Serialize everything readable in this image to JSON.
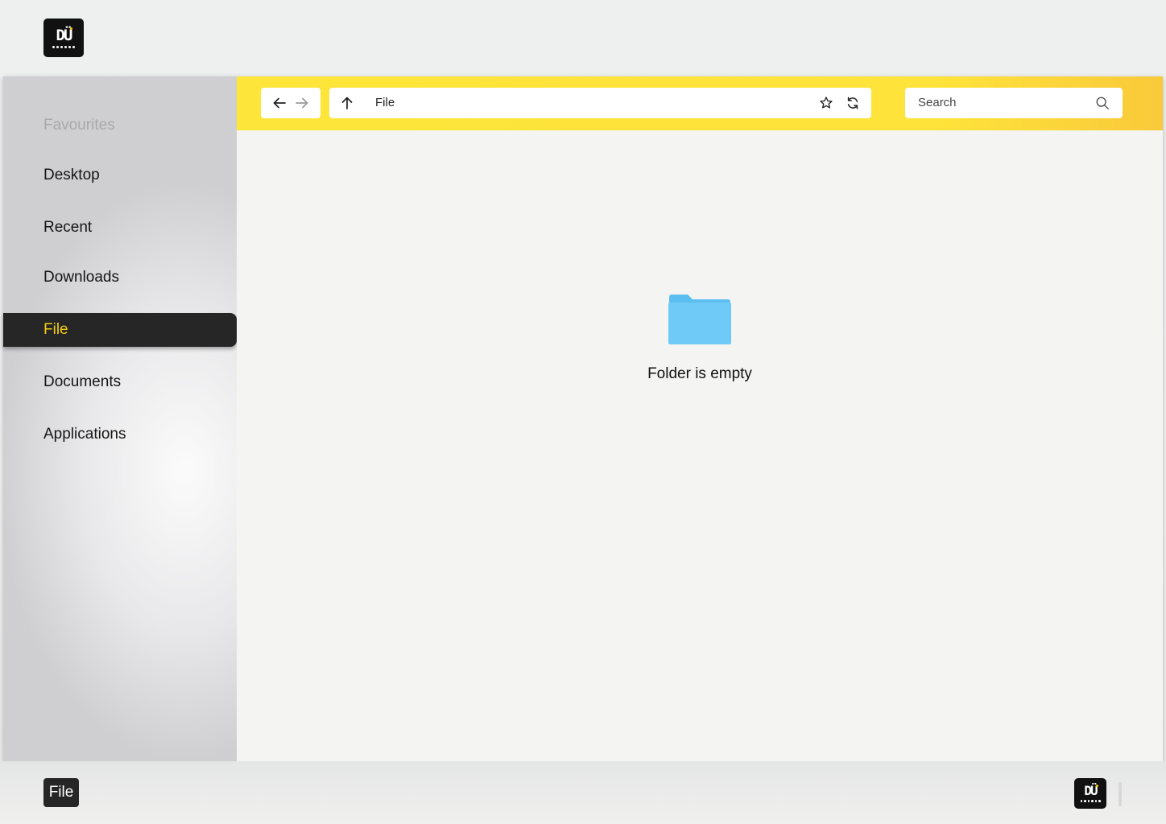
{
  "sidebar": {
    "heading": "Favourites",
    "items": [
      {
        "label": "Desktop"
      },
      {
        "label": "Recent"
      },
      {
        "label": "Downloads"
      },
      {
        "label": "File"
      },
      {
        "label": "Documents"
      },
      {
        "label": "Applications"
      }
    ],
    "active_item": "File"
  },
  "toolbar": {
    "address": "File",
    "search_placeholder": "Search"
  },
  "main": {
    "empty_message": "Folder is empty"
  },
  "taskbar": {
    "open_app_label": "File"
  },
  "colors": {
    "accent_yellow": "#fee43a",
    "active_text": "#f4cc12",
    "dark": "#262626",
    "folder_blue": "#6fcaf8"
  },
  "icons": {
    "logo": "du-logo-icon",
    "back": "arrow-left-icon",
    "forward": "arrow-right-icon",
    "up": "arrow-up-icon",
    "favorite": "star-icon",
    "refresh": "refresh-icon",
    "search": "search-icon",
    "folder": "folder-icon"
  }
}
